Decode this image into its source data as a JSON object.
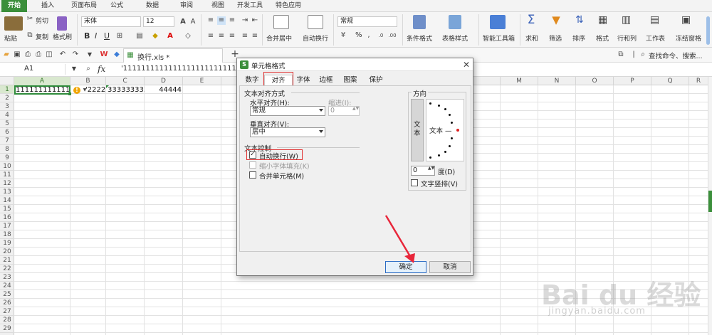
{
  "menu_tabs": [
    "开始",
    "插入",
    "页面布局",
    "公式",
    "数据",
    "审阅",
    "视图",
    "开发工具",
    "特色应用"
  ],
  "ribbon": {
    "paste": "粘贴",
    "cut": "剪切",
    "copy": "复制",
    "format_painter": "格式刷",
    "font_name": "宋体",
    "font_size": "12",
    "bold": "B",
    "italic": "I",
    "underline": "U",
    "merge_center": "合并居中",
    "wrap_text": "自动换行",
    "number_format": "常规",
    "percent": "%",
    "conditional_format": "条件格式",
    "table_style": "表格样式",
    "smart_toolbox": "智能工具箱",
    "sum": "求和",
    "filter": "筛选",
    "sort": "排序",
    "format": "格式",
    "row_col": "行和列",
    "worksheet": "工作表",
    "freeze": "冻结窗格"
  },
  "qat": {
    "file_tab": "换行.xls *",
    "search_placeholder": "查找命令、搜索..."
  },
  "formula_bar": {
    "name_box": "A1",
    "fx": "fx",
    "content": "'1111111111111111111111111"
  },
  "columns": [
    "A",
    "B",
    "C",
    "D",
    "E",
    "M",
    "N",
    "O",
    "P",
    "Q",
    "R"
  ],
  "rows": [
    "1",
    "2",
    "3",
    "4",
    "5",
    "6",
    "7",
    "8",
    "9",
    "10",
    "11",
    "12",
    "13",
    "14",
    "15",
    "16",
    "17",
    "18",
    "19",
    "20",
    "21",
    "22",
    "23",
    "24",
    "25",
    "26",
    "27",
    "28",
    "29"
  ],
  "cells": {
    "a1": "1111111111111",
    "b1": "'2222",
    "c1": "333333333",
    "d1": "44444"
  },
  "dialog": {
    "title": "单元格格式",
    "tabs": [
      "数字",
      "对齐",
      "字体",
      "边框",
      "图案",
      "保护"
    ],
    "active_tab": "对齐",
    "text_align_section": "文本对齐方式",
    "horizontal_label": "水平对齐(H):",
    "horizontal_value": "常规",
    "indent_label": "缩进(I):",
    "indent_value": "0",
    "vertical_label": "垂直对齐(V):",
    "vertical_value": "居中",
    "text_control_section": "文本控制",
    "wrap_text": "自动换行(W)",
    "wrap_checked": true,
    "shrink_to_fit": "缩小字体填充(K)",
    "merge_cells": "合并单元格(M)",
    "orientation_section": "方向",
    "vertical_text": "文本",
    "orientation_text": "文本 —",
    "degree_value": "0",
    "degree_label": "度(D)",
    "vertical_stack": "文字竖排(V)",
    "ok": "确定",
    "cancel": "取消"
  },
  "watermark": {
    "brand": "Bai du 经验",
    "url": "jingyan.baidu.com"
  },
  "colors": {
    "accent_green": "#3b8f3b",
    "highlight_red": "#e03030",
    "arrow_red": "#e8263a"
  }
}
